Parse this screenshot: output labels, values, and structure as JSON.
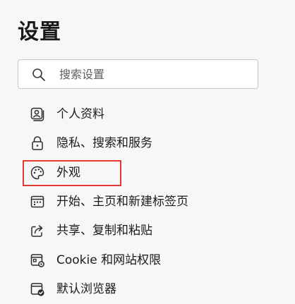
{
  "page": {
    "title": "设置"
  },
  "search": {
    "placeholder": "搜索设置",
    "value": "",
    "icon": "search-icon"
  },
  "nav": {
    "items": [
      {
        "label": "个人资料",
        "icon": "profile-icon"
      },
      {
        "label": "隐私、搜索和服务",
        "icon": "lock-icon"
      },
      {
        "label": "外观",
        "icon": "palette-icon",
        "highlighted": true
      },
      {
        "label": "开始、主页和新建标签页",
        "icon": "start-page-icon"
      },
      {
        "label": "共享、复制和粘贴",
        "icon": "share-icon"
      },
      {
        "label": "Cookie 和网站权限",
        "icon": "site-permissions-icon"
      },
      {
        "label": "默认浏览器",
        "icon": "default-browser-icon"
      }
    ]
  },
  "colors": {
    "background": "#f7f7f7",
    "highlight": "#e53935",
    "text": "#1b1b1b"
  }
}
